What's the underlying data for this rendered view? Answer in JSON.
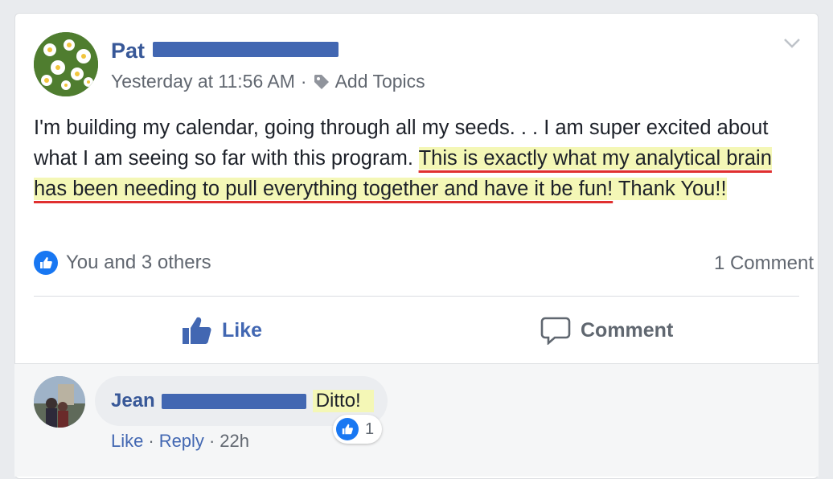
{
  "post": {
    "author": "Pat",
    "timestamp": "Yesterday at 11:56 AM",
    "separator": "·",
    "add_topics": "Add Topics",
    "text_part1": "I'm building my calendar, going through all my seeds. . . I am super excited about what I am seeing so far with this program. ",
    "text_highlight": "This is exactly what my analytical brain has been needing to pull everything together and have it be fun!",
    "text_part2": " Thank You!!",
    "reactions_text": "You and 3 others",
    "comment_count": "1 Comment",
    "like_label": "Like",
    "comment_label": "Comment"
  },
  "comment": {
    "author": "Jean",
    "text": "Ditto!",
    "reaction_count": "1",
    "like_label": "Like",
    "reply_label": "Reply",
    "time": "22h",
    "separator": "·"
  },
  "icons": {
    "like": "thumbs-up-icon",
    "comment": "speech-bubble-icon",
    "tag": "tag-icon",
    "chevron": "chevron-down-icon"
  },
  "colors": {
    "link_blue": "#385898",
    "like_blue": "#1877f2",
    "highlight": "#f4f7b6",
    "underline_red": "#e02f2f"
  }
}
